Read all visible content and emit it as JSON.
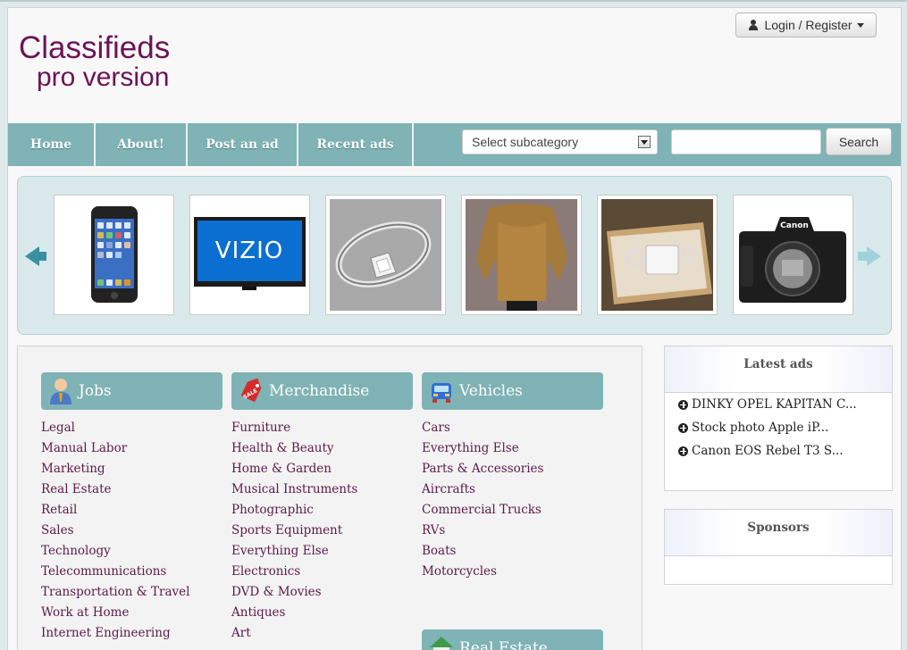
{
  "header": {
    "logo_title": "Classifieds",
    "logo_subtitle": "pro version",
    "login_label": "Login / Register"
  },
  "nav": {
    "items": [
      "Home",
      "About!",
      "Post an ad",
      "Recent ads"
    ],
    "select_placeholder": "Select subcategory",
    "search_value": "",
    "search_button": "Search"
  },
  "carousel": {
    "items": [
      {
        "icon": "ipod-touch-image"
      },
      {
        "icon": "vizio-tv-image",
        "text": "VIZIO"
      },
      {
        "icon": "diamond-ring-image"
      },
      {
        "icon": "gold-jacket-image"
      },
      {
        "icon": "phone-in-box-image"
      },
      {
        "icon": "canon-camera-image",
        "text": "Canon"
      }
    ]
  },
  "categories": [
    {
      "title": "Jobs",
      "icon": "person-icon",
      "links": [
        "Legal",
        "Manual Labor",
        "Marketing",
        "Real Estate",
        "Retail",
        "Sales",
        "Technology",
        "Telecommunications",
        "Transportation & Travel",
        "Work at Home",
        "Internet Engineering"
      ]
    },
    {
      "title": "Merchandise",
      "icon": "sale-tag-icon",
      "icon_text": "SALE",
      "links": [
        "Furniture",
        "Health & Beauty",
        "Home & Garden",
        "Musical Instruments",
        "Photographic",
        "Sports Equipment",
        "Everything Else",
        "Electronics",
        "DVD & Movies",
        "Antiques",
        "Art"
      ]
    },
    {
      "title": "Vehicles",
      "icon": "car-icon",
      "links": [
        "Cars",
        "Everything Else",
        "Parts & Accessories",
        "Aircrafts",
        "Commercial Trucks",
        "RVs",
        "Boats",
        "Motorcycles"
      ]
    },
    {
      "title": "Real Estate",
      "icon": "house-icon",
      "links": []
    }
  ],
  "sidebar": {
    "latest_title": "Latest ads",
    "latest_items": [
      "DINKY OPEL KAPITAN C...",
      "Stock photo Apple iP...",
      "Canon EOS Rebel T3 S..."
    ],
    "sponsors_title": "Sponsors"
  },
  "colors": {
    "brand": "#6b1357",
    "nav_teal": "#7fb3b5",
    "link": "#5c1a4b"
  }
}
